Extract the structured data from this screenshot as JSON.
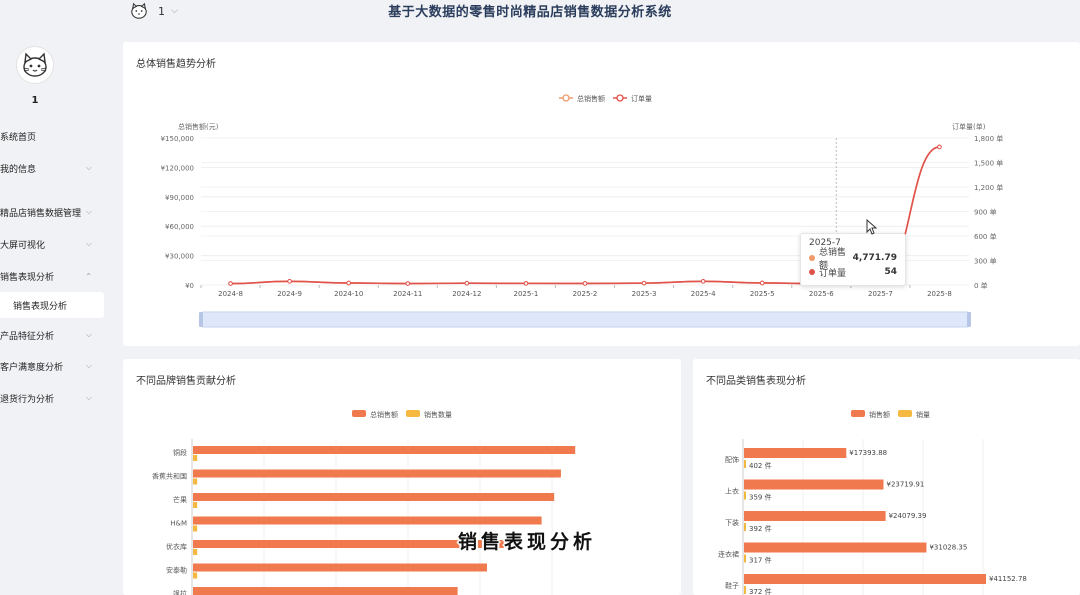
{
  "header": {
    "title": "基于大数据的零售时尚精品店销售数据分析系统",
    "user": "1"
  },
  "sidebar": {
    "username": "1",
    "items": [
      {
        "label": "系统首页",
        "chevron": false
      },
      {
        "label": "我的信息",
        "chevron": true
      },
      {
        "label": "精品店销售数据管理",
        "chevron": true
      },
      {
        "label": "大屏可视化",
        "chevron": true
      },
      {
        "label": "销售表现分析",
        "chevron": true,
        "expanded": true
      },
      {
        "label": "产品特征分析",
        "chevron": true
      },
      {
        "label": "客户满意度分析",
        "chevron": true
      },
      {
        "label": "退货行为分析",
        "chevron": true
      }
    ],
    "active_sub": "销售表现分析"
  },
  "trend": {
    "title": "总体销售趋势分析",
    "tooltip": {
      "period": "2025-7",
      "rows": [
        {
          "name": "总销售额",
          "value": "4,771.79",
          "color": "#ee9a6a"
        },
        {
          "name": "订单量",
          "value": "54",
          "color": "#e0524c"
        }
      ]
    }
  },
  "brand": {
    "title": "不同品牌销售贡献分析"
  },
  "category": {
    "title": "不同品类销售表现分析"
  },
  "watermark": "销售表现分析",
  "chart_data": [
    {
      "type": "line",
      "title": "总体销售趋势分析",
      "x": [
        "2024-8",
        "2024-9",
        "2024-10",
        "2024-11",
        "2024-12",
        "2025-1",
        "2025-2",
        "2025-3",
        "2025-4",
        "2025-5",
        "2025-6",
        "2025-7",
        "2025-8"
      ],
      "ylabel": "总销售额(元)",
      "y2label": "订单量(单)",
      "ylim": [
        0,
        150000
      ],
      "y2lim": [
        0,
        1800
      ],
      "yticks": [
        "¥0",
        "¥30,000",
        "¥60,000",
        "¥90,000",
        "¥120,000",
        "¥150,000"
      ],
      "y2ticks": [
        "0 单",
        "300 单",
        "600 单",
        "900 单",
        "1,200 单",
        "1,500 单",
        "1,800 单"
      ],
      "legend": [
        "总销售额",
        "订单量"
      ],
      "legend_position": "top-center",
      "series": [
        {
          "name": "总销售额",
          "axis": "left",
          "color": "#ee9a6a",
          "values": [
            1500,
            3800,
            2000,
            1500,
            1800,
            1700,
            1600,
            1900,
            3800,
            2100,
            1300,
            4771.79,
            141000
          ]
        },
        {
          "name": "订单量",
          "axis": "right",
          "color": "#e0524c",
          "values": [
            18,
            45,
            25,
            18,
            22,
            20,
            19,
            23,
            45,
            25,
            16,
            54,
            1690
          ]
        }
      ]
    },
    {
      "type": "bar",
      "orientation": "horizontal",
      "title": "不同品牌销售贡献分析",
      "categories": [
        "铜段",
        "香蕉共和国",
        "芒果",
        "H&M",
        "优衣库",
        "安泰勒",
        "飒拉"
      ],
      "legend": [
        "总销售额",
        "销售数量"
      ],
      "legend_position": "top-center",
      "xlim": [
        0,
        1
      ],
      "series": [
        {
          "name": "总销售额",
          "color": "#f07a4e",
          "values": [
            0.91,
            0.876,
            0.86,
            0.83,
            0.74,
            0.7,
            0.63
          ]
        },
        {
          "name": "销售数量",
          "color": "#f5b942",
          "values": [
            0.01,
            0.01,
            0.01,
            0.01,
            0.01,
            0.01,
            0.01
          ]
        }
      ]
    },
    {
      "type": "bar",
      "orientation": "horizontal",
      "title": "不同品类销售表现分析",
      "categories": [
        "配饰",
        "上衣",
        "下装",
        "连衣裙",
        "鞋子"
      ],
      "legend": [
        "销售额",
        "销量"
      ],
      "legend_position": "top-center",
      "series": [
        {
          "name": "销售额",
          "color": "#f07a4e",
          "values": [
            17393.88,
            23719.91,
            24079.39,
            31028.35,
            41152.78
          ],
          "labels": [
            "¥17393.88",
            "¥23719.91",
            "¥24079.39",
            "¥31028.35",
            "¥41152.78"
          ]
        },
        {
          "name": "销量",
          "color": "#f5b942",
          "values": [
            402,
            359,
            392,
            317,
            372
          ],
          "labels": [
            "402 件",
            "359 件",
            "392 件",
            "317 件",
            "372 件"
          ]
        }
      ]
    }
  ]
}
